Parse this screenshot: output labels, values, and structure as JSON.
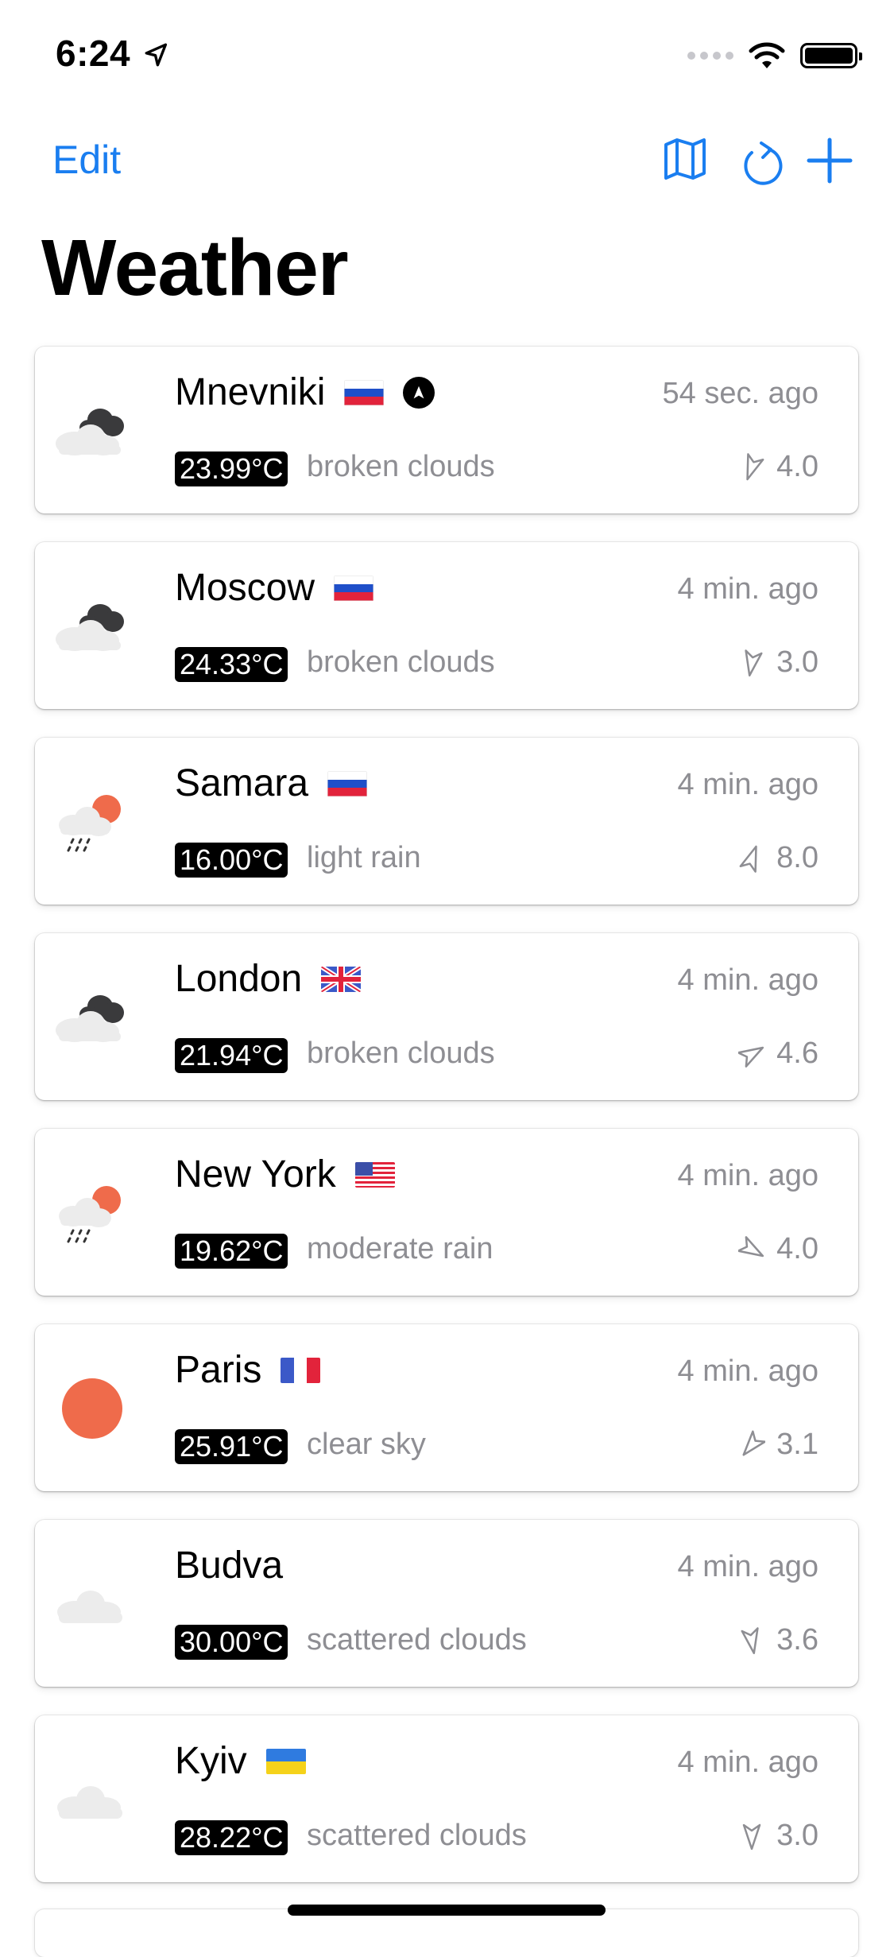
{
  "status_bar": {
    "time": "6:24"
  },
  "nav": {
    "edit_label": "Edit",
    "title": "Weather"
  },
  "colors": {
    "accent": "#1a7ef0",
    "sun": "#ef6b4b",
    "cloud_dark": "#3a3a3c",
    "cloud_light": "#ececec"
  },
  "cities": [
    {
      "name": "Mnevniki",
      "flag": "ru",
      "current_location": true,
      "time_ago": "54 sec. ago",
      "temp": "23.99°C",
      "desc": "broken clouds",
      "wind": "4.0",
      "wind_deg": 200,
      "icon": "broken-clouds-icon"
    },
    {
      "name": "Moscow",
      "flag": "ru",
      "current_location": false,
      "time_ago": "4 min. ago",
      "temp": "24.33°C",
      "desc": "broken clouds",
      "wind": "3.0",
      "wind_deg": 190,
      "icon": "broken-clouds-icon"
    },
    {
      "name": "Samara",
      "flag": "ru",
      "current_location": false,
      "time_ago": "4 min. ago",
      "temp": "16.00°C",
      "desc": "light rain",
      "wind": "8.0",
      "wind_deg": 20,
      "icon": "rain-icon"
    },
    {
      "name": "London",
      "flag": "gb",
      "current_location": false,
      "time_ago": "4 min. ago",
      "temp": "21.94°C",
      "desc": "broken clouds",
      "wind": "4.6",
      "wind_deg": 60,
      "icon": "broken-clouds-icon"
    },
    {
      "name": "New York",
      "flag": "us",
      "current_location": false,
      "time_ago": "4 min. ago",
      "temp": "19.62°C",
      "desc": "moderate rain",
      "wind": "4.0",
      "wind_deg": 120,
      "icon": "rain-icon"
    },
    {
      "name": "Paris",
      "flag": "fr",
      "current_location": false,
      "time_ago": "4 min. ago",
      "temp": "25.91°C",
      "desc": "clear sky",
      "wind": "3.1",
      "wind_deg": 220,
      "icon": "sun-icon"
    },
    {
      "name": "Budva",
      "flag": "",
      "current_location": false,
      "time_ago": "4 min. ago",
      "temp": "30.00°C",
      "desc": "scattered clouds",
      "wind": "3.6",
      "wind_deg": 170,
      "icon": "scattered-clouds-icon"
    },
    {
      "name": "Kyiv",
      "flag": "ua",
      "current_location": false,
      "time_ago": "4 min. ago",
      "temp": "28.22°C",
      "desc": "scattered clouds",
      "wind": "3.0",
      "wind_deg": 180,
      "icon": "scattered-clouds-icon"
    }
  ]
}
